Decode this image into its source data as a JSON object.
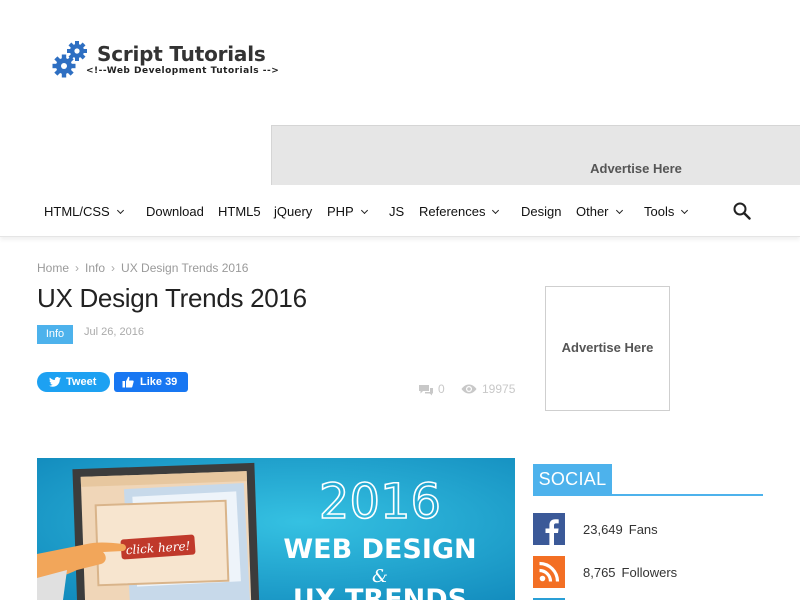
{
  "site": {
    "title": "Script Tutorials",
    "tagline": "<!--Web Development Tutorials -->"
  },
  "ads": {
    "top": "Advertise Here",
    "side": "Advertise Here"
  },
  "nav": {
    "items": [
      {
        "label": "HTML/CSS",
        "dropdown": true
      },
      {
        "label": "Download",
        "dropdown": false
      },
      {
        "label": "HTML5",
        "dropdown": false
      },
      {
        "label": "jQuery",
        "dropdown": false
      },
      {
        "label": "PHP",
        "dropdown": true
      },
      {
        "label": "JS",
        "dropdown": false
      },
      {
        "label": "References",
        "dropdown": true
      },
      {
        "label": "Design",
        "dropdown": false
      },
      {
        "label": "Other",
        "dropdown": true
      },
      {
        "label": "Tools",
        "dropdown": true
      }
    ],
    "search_icon": "search-icon"
  },
  "breadcrumb": [
    "Home",
    "Info",
    "UX Design Trends 2016"
  ],
  "post": {
    "title": "UX Design Trends 2016",
    "category": "Info",
    "date": "Jul 26, 2016",
    "comments": "0",
    "views": "19975"
  },
  "share": {
    "tweet": "Tweet",
    "like": "Like 39"
  },
  "featured": {
    "year": "2016",
    "line1": "WEB DESIGN",
    "amp": "&",
    "line2": "UX TRENDS",
    "cta": "click here!"
  },
  "social": {
    "heading": "SOCIAL",
    "items": [
      {
        "icon": "facebook-icon",
        "count": "23,649",
        "label": "Fans",
        "color": "#3b5998"
      },
      {
        "icon": "rss-icon",
        "count": "8,765",
        "label": "Followers",
        "color": "#f36f24"
      }
    ]
  },
  "colors": {
    "accent": "#4db2ec",
    "twitter": "#1da1f2",
    "facebook_like": "#1877f2"
  }
}
